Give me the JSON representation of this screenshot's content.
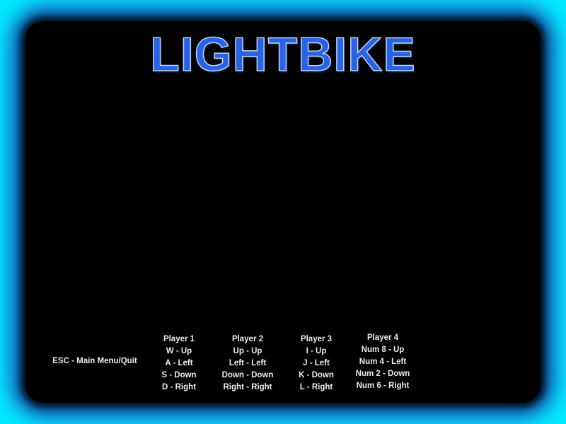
{
  "title": "LIGHTBIKE",
  "menu_hint": "ESC - Main Menu/Quit",
  "players": [
    {
      "name": "Player 1",
      "controls": [
        "W - Up",
        "A - Left",
        "S - Down",
        "D - Right"
      ]
    },
    {
      "name": "Player 2",
      "controls": [
        "Up - Up",
        "Left - Left",
        "Down - Down",
        "Right - Right"
      ]
    },
    {
      "name": "Player 3",
      "controls": [
        "I - Up",
        "J - Left",
        "K - Down",
        "L - Right"
      ]
    },
    {
      "name": "Player 4",
      "controls": [
        "Num 8 - Up",
        "Num 4 - Left",
        "Num 2 - Down",
        "Num 6 - Right"
      ]
    }
  ],
  "colors": {
    "border_glow": "#00f0ff",
    "arena": "#000000",
    "title": "#2563eb",
    "text": "#ececec"
  }
}
